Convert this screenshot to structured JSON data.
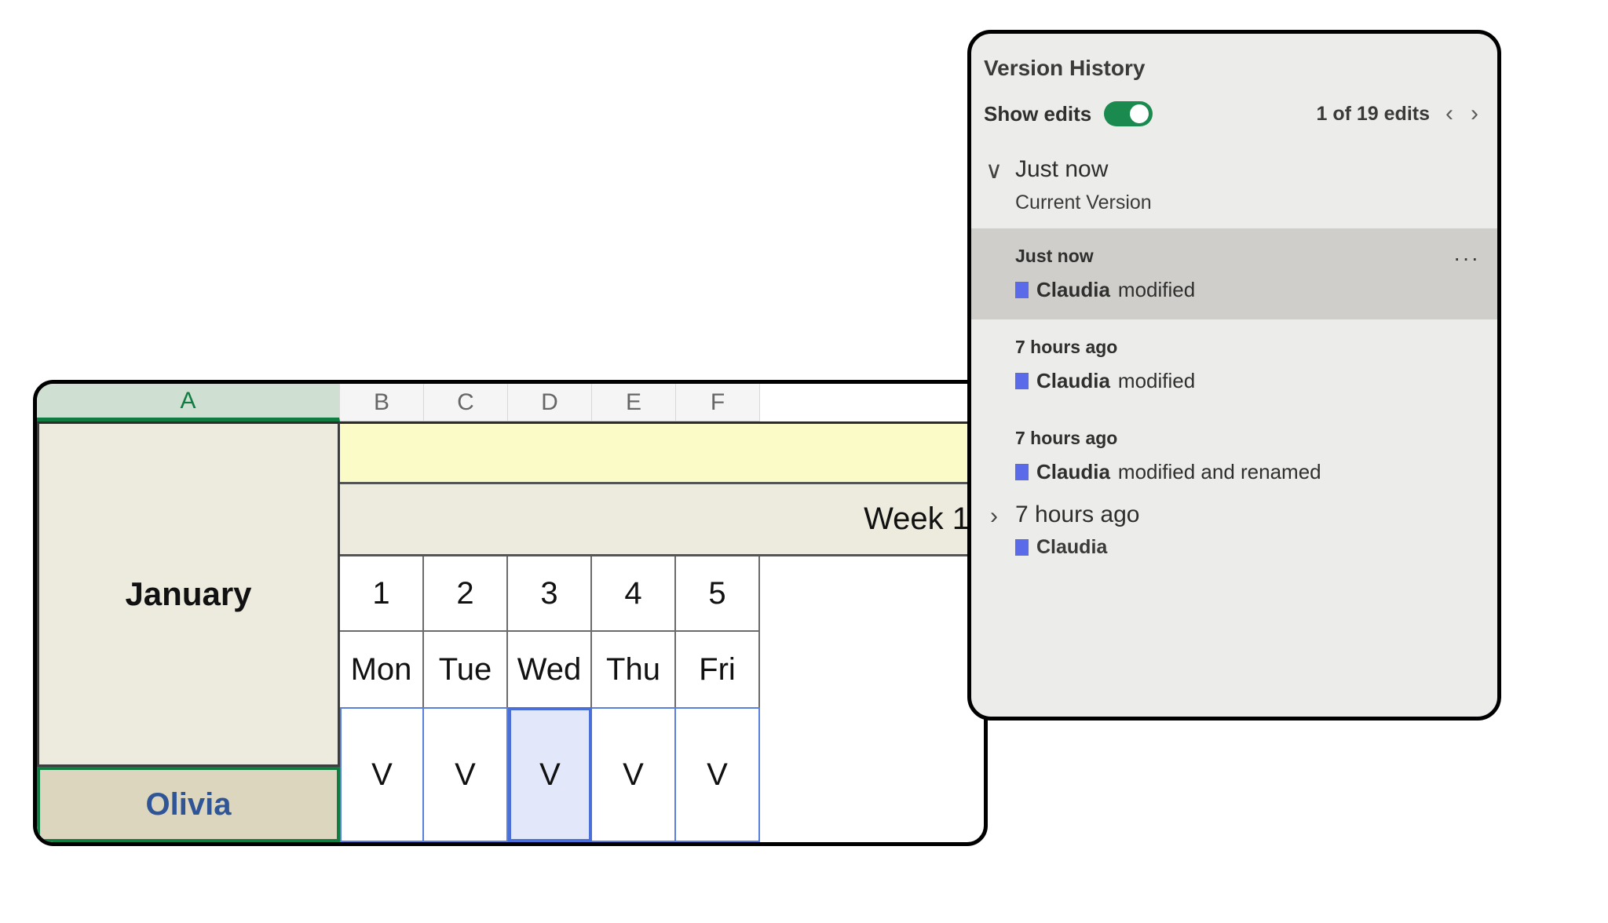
{
  "spreadsheet": {
    "columns": [
      {
        "label": "A",
        "selected": true
      },
      {
        "label": "B",
        "selected": false
      },
      {
        "label": "C",
        "selected": false
      },
      {
        "label": "D",
        "selected": false
      },
      {
        "label": "E",
        "selected": false
      },
      {
        "label": "F",
        "selected": false
      }
    ],
    "month_cell": "January",
    "name_cell": "Olivia",
    "week_header": "Week 1",
    "day_numbers": [
      "1",
      "2",
      "3",
      "4",
      "5"
    ],
    "day_names": [
      "Mon",
      "Tue",
      "Wed",
      "Thu",
      "Fri"
    ],
    "values": [
      "V",
      "V",
      "V",
      "V",
      "V"
    ],
    "active_cell_index": 2,
    "colors": {
      "selected_column_header_bg": "#cfe0d2",
      "selected_column_header_text": "#107c41",
      "selection_border": "#107c41",
      "merged_cell_bg": "#edeade",
      "name_cell_bg": "#dcd6bf",
      "name_cell_text": "#2f5597",
      "banner_row_bg": "#fbfbc8",
      "active_cell_bg": "#e2e7fa",
      "range_border": "#5b7fe0"
    }
  },
  "version_history": {
    "title": "Version History",
    "show_edits_label": "Show edits",
    "show_edits_on": true,
    "count_label": "1 of 19 edits",
    "prev_icon": "‹",
    "next_icon": "›",
    "expanded_caret": "∨",
    "collapsed_caret": "›",
    "more_icon": "···",
    "groups": [
      {
        "title": "Just now",
        "subtitle": "Current Version",
        "expanded": true,
        "entries": [
          {
            "time": "Just now",
            "author": "Claudia",
            "action": " modified",
            "selected": true,
            "has_more_menu": true
          },
          {
            "time": "7 hours ago",
            "author": "Claudia",
            "action": " modified",
            "selected": false,
            "has_more_menu": false
          },
          {
            "time": "7 hours ago",
            "author": "Claudia",
            "action": " modified and renamed",
            "selected": false,
            "has_more_menu": false
          }
        ]
      },
      {
        "title": "7 hours ago",
        "author": "Claudia",
        "expanded": false,
        "entries": []
      }
    ],
    "colors": {
      "panel_bg": "#ececea",
      "selected_entry_bg": "#cfcecb",
      "toggle_on": "#1a8a4f",
      "author_chip": "#5b6ae8"
    }
  }
}
